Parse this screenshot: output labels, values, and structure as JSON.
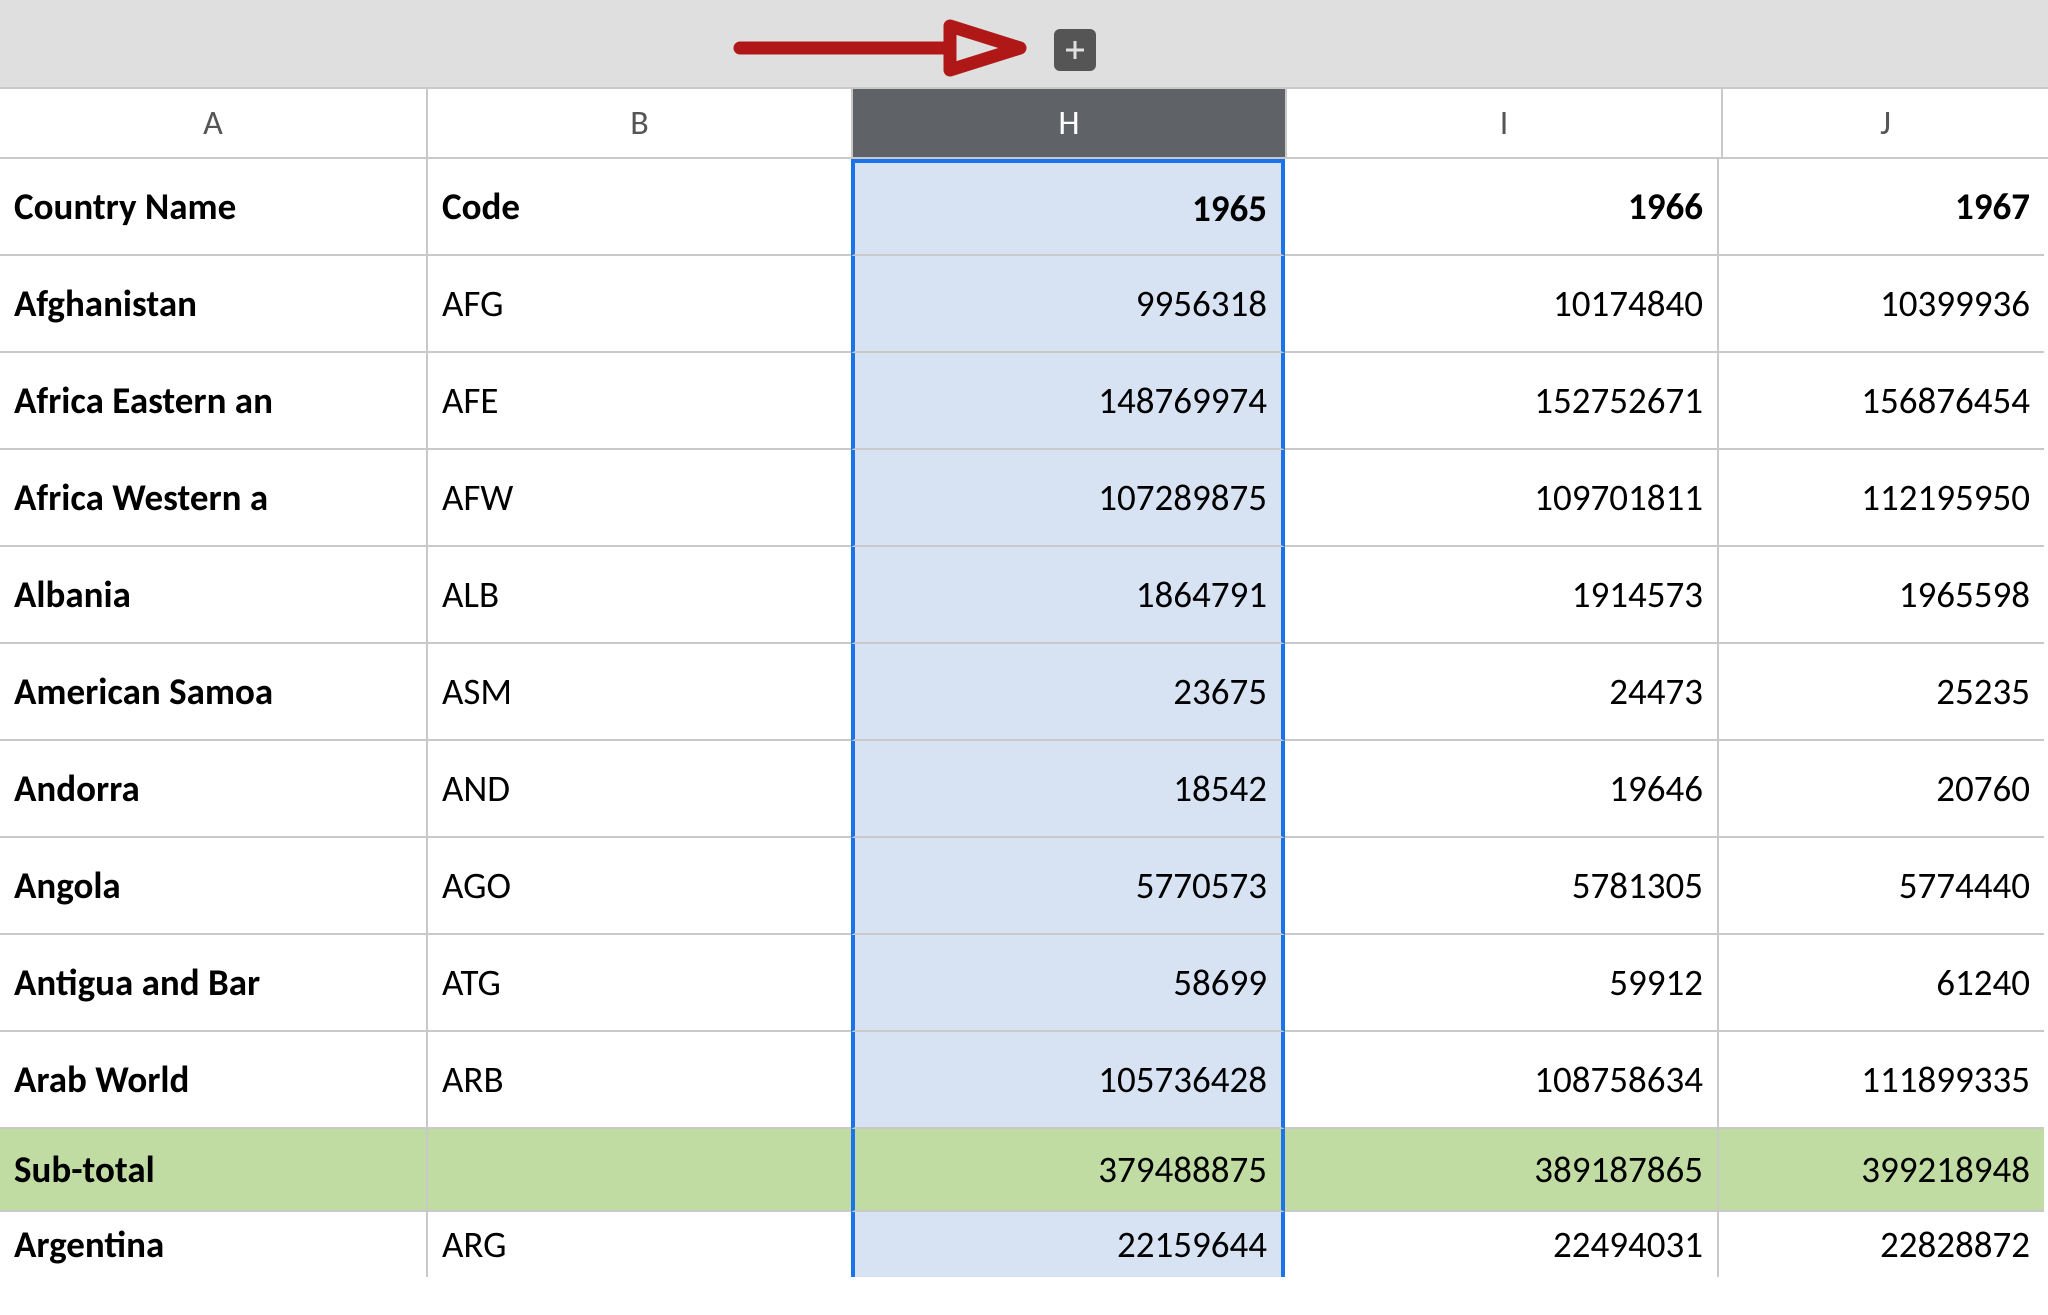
{
  "columns": {
    "a": "A",
    "b": "B",
    "h": "H",
    "i": "I",
    "j": "J"
  },
  "selected_column": "H",
  "header_row": {
    "country": "Country Name",
    "code": "Code",
    "y1965": "1965",
    "y1966": "1966",
    "y1967": "1967"
  },
  "rows": [
    {
      "country": "Afghanistan",
      "code": "AFG",
      "y1965": "9956318",
      "y1966": "10174840",
      "y1967": "10399936"
    },
    {
      "country": "Africa Eastern an",
      "code": "AFE",
      "y1965": "148769974",
      "y1966": "152752671",
      "y1967": "156876454"
    },
    {
      "country": "Africa Western a",
      "code": "AFW",
      "y1965": "107289875",
      "y1966": "109701811",
      "y1967": "112195950"
    },
    {
      "country": "Albania",
      "code": "ALB",
      "y1965": "1864791",
      "y1966": "1914573",
      "y1967": "1965598"
    },
    {
      "country": "American Samoa",
      "code": "ASM",
      "y1965": "23675",
      "y1966": "24473",
      "y1967": "25235"
    },
    {
      "country": "Andorra",
      "code": "AND",
      "y1965": "18542",
      "y1966": "19646",
      "y1967": "20760"
    },
    {
      "country": "Angola",
      "code": "AGO",
      "y1965": "5770573",
      "y1966": "5781305",
      "y1967": "5774440"
    },
    {
      "country": "Antigua and Bar",
      "code": "ATG",
      "y1965": "58699",
      "y1966": "59912",
      "y1967": "61240"
    },
    {
      "country": "Arab World",
      "code": "ARB",
      "y1965": "105736428",
      "y1966": "108758634",
      "y1967": "111899335"
    }
  ],
  "subtotal": {
    "label": "Sub-total",
    "code": "",
    "y1965": "379488875",
    "y1966": "389187865",
    "y1967": "399218948"
  },
  "partial_row": {
    "country": "Argentina",
    "code": "ARG",
    "y1965": "22159644",
    "y1966": "22494031",
    "y1967": "22828872"
  }
}
